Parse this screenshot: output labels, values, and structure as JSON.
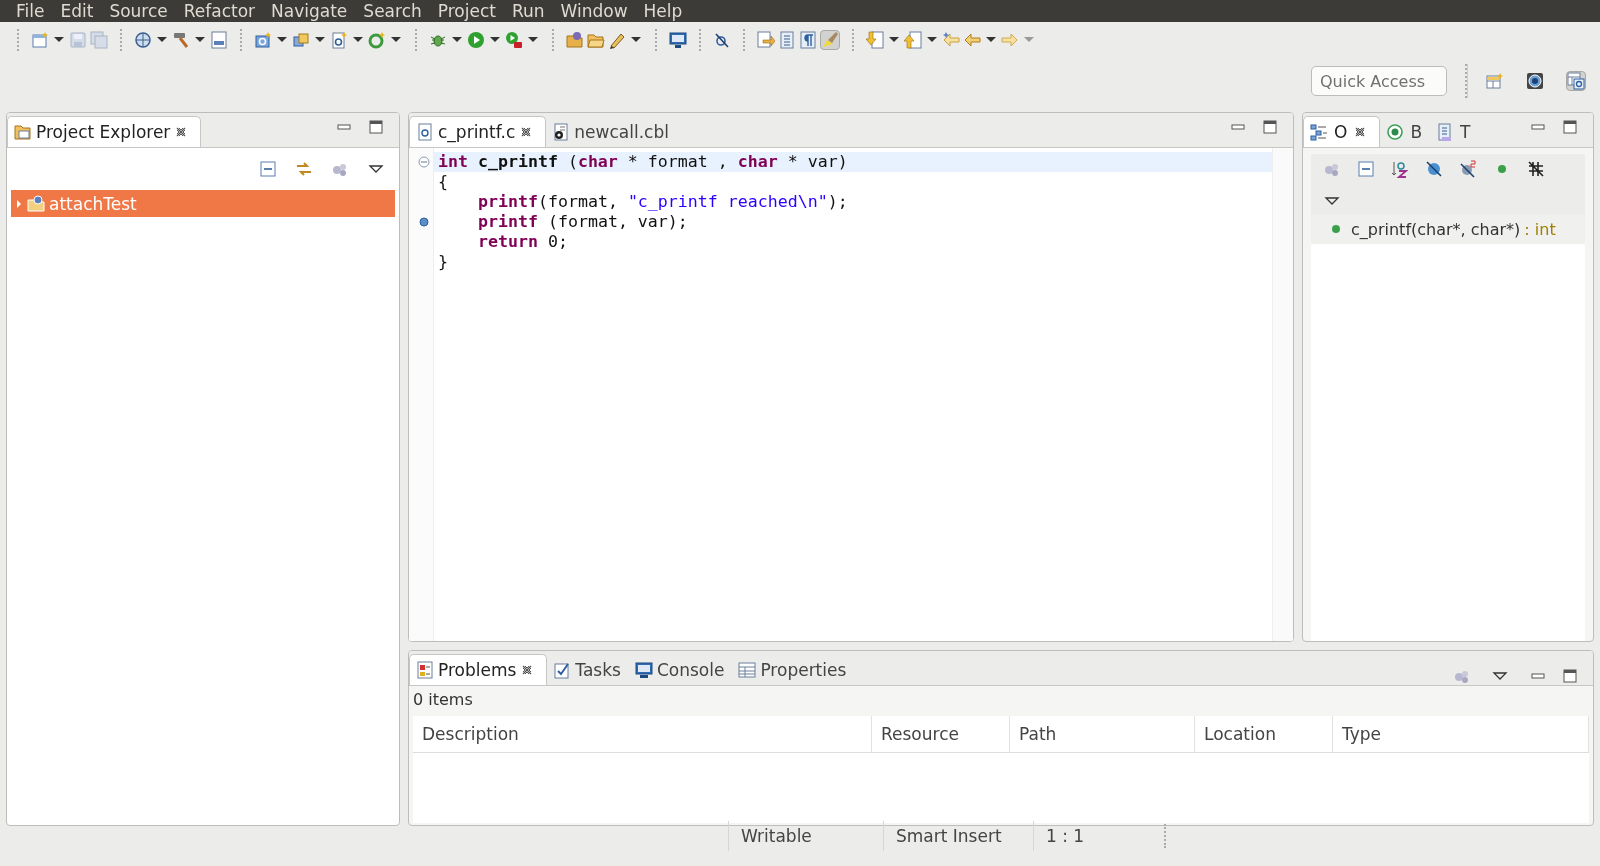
{
  "menu": [
    {
      "label": "File"
    },
    {
      "label": "Edit"
    },
    {
      "label": "Source"
    },
    {
      "label": "Refactor"
    },
    {
      "label": "Navigate"
    },
    {
      "label": "Search"
    },
    {
      "label": "Project"
    },
    {
      "label": "Run"
    },
    {
      "label": "Window"
    },
    {
      "label": "Help"
    }
  ],
  "quick_access": {
    "placeholder": "Quick Access"
  },
  "project_explorer": {
    "tabs": [
      {
        "label": "Project Explorer",
        "selected": true
      }
    ],
    "tree": [
      {
        "label": "attachTest",
        "selected": true,
        "expanded": false
      }
    ]
  },
  "editor": {
    "tabs": [
      {
        "label": "c_printf.c",
        "kind": "c",
        "selected": true
      },
      {
        "label": "newcall.cbl",
        "kind": "cobol",
        "selected": false
      }
    ],
    "lines": [
      {
        "highlighted": true,
        "indented": false,
        "foldable": true,
        "marker": false,
        "tokens": [
          {
            "kind": "keyword",
            "text": "int"
          },
          {
            "kind": "function",
            "text": " c_printf"
          },
          {
            "kind": "plain",
            "text": " ("
          },
          {
            "kind": "keyword",
            "text": "char"
          },
          {
            "kind": "plain",
            "text": " * format , "
          },
          {
            "kind": "keyword",
            "text": "char"
          },
          {
            "kind": "plain",
            "text": " * var)"
          }
        ]
      },
      {
        "highlighted": false,
        "indented": false,
        "foldable": false,
        "marker": false,
        "tokens": [
          {
            "kind": "plain",
            "text": "{"
          }
        ]
      },
      {
        "highlighted": false,
        "indented": true,
        "foldable": false,
        "marker": false,
        "tokens": [
          {
            "kind": "keyword",
            "text": "printf"
          },
          {
            "kind": "plain",
            "text": "(format, "
          },
          {
            "kind": "string",
            "text": "\"c_printf reached\\n\""
          },
          {
            "kind": "plain",
            "text": ");"
          }
        ]
      },
      {
        "highlighted": false,
        "indented": true,
        "foldable": false,
        "marker": true,
        "tokens": [
          {
            "kind": "keyword",
            "text": "printf"
          },
          {
            "kind": "plain",
            "text": " (format, var);"
          }
        ]
      },
      {
        "highlighted": false,
        "indented": true,
        "foldable": false,
        "marker": false,
        "tokens": [
          {
            "kind": "keyword",
            "text": "return"
          },
          {
            "kind": "plain",
            "text": " 0;"
          }
        ]
      },
      {
        "highlighted": false,
        "indented": false,
        "foldable": false,
        "marker": false,
        "tokens": [
          {
            "kind": "plain",
            "text": "}"
          }
        ]
      }
    ]
  },
  "outline": {
    "tabs": [
      {
        "label": "O",
        "kind": "outline",
        "selected": true
      },
      {
        "label": "B",
        "kind": "breakpoints",
        "selected": false
      },
      {
        "label": "T",
        "kind": "type",
        "selected": false
      }
    ],
    "items": [
      {
        "name": "c_printf(char*, char*)",
        "type": ": int",
        "selected": true
      }
    ]
  },
  "problems": {
    "tabs": [
      {
        "label": "Problems",
        "kind": "problems",
        "selected": true
      },
      {
        "label": "Tasks",
        "kind": "tasks",
        "selected": false
      },
      {
        "label": "Console",
        "kind": "console",
        "selected": false
      },
      {
        "label": "Properties",
        "kind": "properties",
        "selected": false
      }
    ],
    "summary": "0 items",
    "columns": [
      "Description",
      "Resource",
      "Path",
      "Location",
      "Type"
    ]
  },
  "status_bar": [
    "Writable",
    "Smart Insert",
    "1 : 1"
  ]
}
